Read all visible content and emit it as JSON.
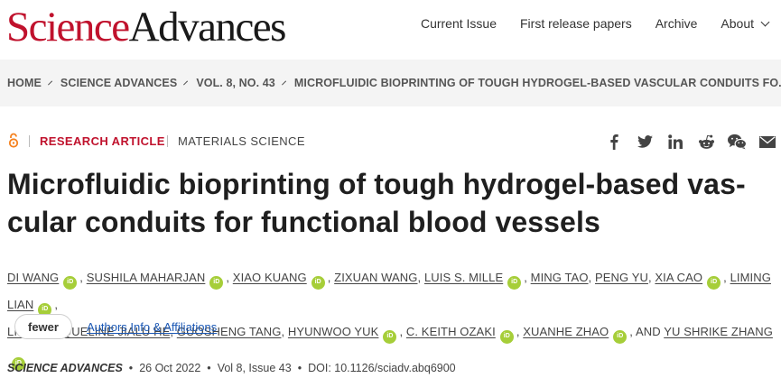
{
  "header": {
    "logo_science": "Science",
    "logo_advances": "Advances",
    "nav": [
      "Current Issue",
      "First release papers",
      "Archive",
      "About"
    ]
  },
  "breadcrumb": [
    "HOME",
    "SCIENCE ADVANCES",
    "VOL. 8, NO. 43",
    "MICROFLUIDIC BIOPRINTING OF TOUGH HYDROGEL-BASED VASCULAR CONDUITS FO..."
  ],
  "article": {
    "type": "RESEARCH ARTICLE",
    "subject": "MATERIALS SCIENCE",
    "title": "Microfluidic bioprinting of tough hydrogel-based vas-cular conduits for functional blood vessels",
    "title_line1": "Microfluidic bioprinting of tough hydrogel-based vas-",
    "title_line2": "cular conduits for functional blood vessels"
  },
  "authors": {
    "line1": [
      {
        "name": "DI WANG",
        "orcid": true
      },
      {
        "name": "SUSHILA MAHARJAN",
        "orcid": true
      },
      {
        "name": "XIAO KUANG",
        "orcid": true
      },
      {
        "name": "ZIXUAN WANG",
        "orcid": false
      },
      {
        "name": "LUIS S. MILLE",
        "orcid": true
      },
      {
        "name": "MING TAO",
        "orcid": false
      },
      {
        "name": "PENG YU",
        "orcid": false
      },
      {
        "name": "XIA CAO",
        "orcid": true
      },
      {
        "name": "LIMING LIAN",
        "orcid": true
      }
    ],
    "line2": [
      {
        "name": "LI LV",
        "orcid": false
      },
      {
        "name": "JACQUELINE JIALU HE",
        "orcid": false
      },
      {
        "name": "GUOSHENG TANG",
        "orcid": false
      },
      {
        "name": "HYUNWOO YUK",
        "orcid": true
      },
      {
        "name": "C. KEITH OZAKI",
        "orcid": true
      },
      {
        "name": "XUANHE ZHAO",
        "orcid": true
      },
      {
        "name": "YU SHRIKE ZHANG",
        "orcid": true
      }
    ],
    "and_label": ", AND",
    "orcid_label": "iD",
    "fewer_label": "fewer",
    "affiliations_label": "Authors Info & Affiliations"
  },
  "citation": {
    "journal": "SCIENCE ADVANCES",
    "date": "26 Oct 2022",
    "volume": "Vol 8, Issue 43",
    "doi": "DOI: 10.1126/sciadv.abq6900"
  },
  "share_icons": [
    "facebook-icon",
    "twitter-icon",
    "linkedin-icon",
    "reddit-icon",
    "wechat-icon",
    "email-icon"
  ],
  "colors": {
    "brand_red": "#c0122d",
    "orcid_green": "#a6ce39",
    "link_blue": "#1b58b5",
    "open_access_orange": "#f58220"
  }
}
